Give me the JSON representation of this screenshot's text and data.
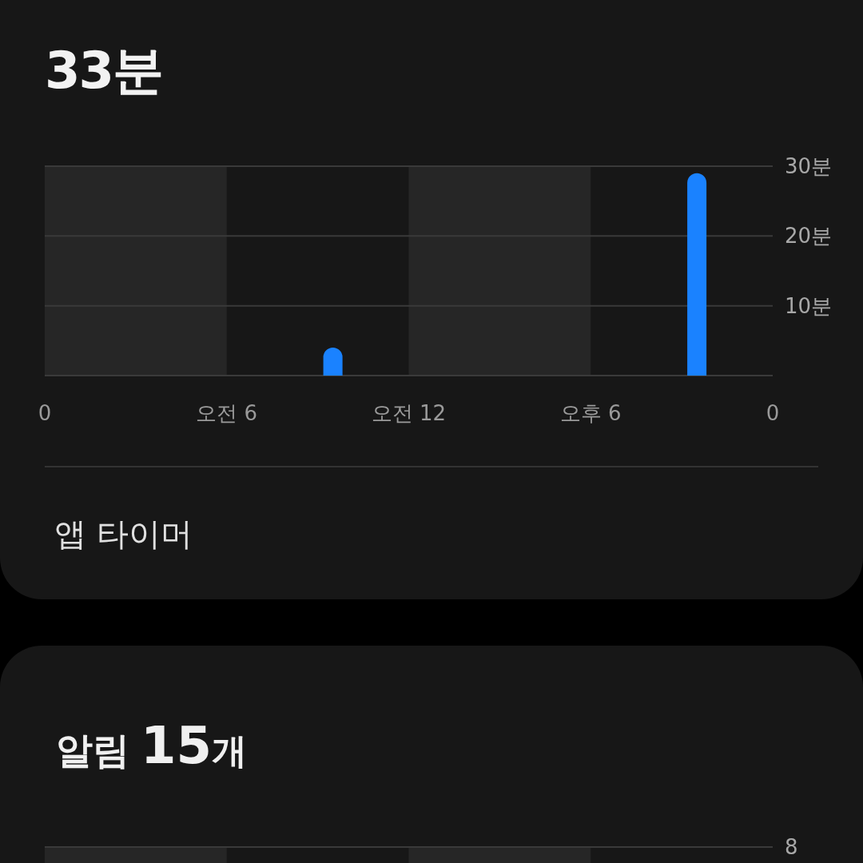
{
  "usage_card": {
    "total": "33분",
    "chart_data": {
      "type": "bar",
      "categories": [
        "0",
        null,
        null,
        null,
        null,
        null,
        "오전 6",
        null,
        null,
        null,
        null,
        null,
        "오전 12",
        null,
        null,
        null,
        null,
        null,
        "오후 6",
        null,
        null,
        null,
        null,
        null
      ],
      "series": [
        {
          "color": "#1a82ff",
          "values": [
            0,
            0,
            0,
            0,
            0,
            0,
            0,
            0,
            0,
            4,
            0,
            0,
            0,
            0,
            0,
            0,
            0,
            0,
            0,
            0,
            0,
            29,
            0,
            0
          ]
        }
      ],
      "ylim": [
        0,
        30
      ],
      "yticks": [
        {
          "value": 10,
          "label": "10분"
        },
        {
          "value": 20,
          "label": "20분"
        },
        {
          "value": 30,
          "label": "30분"
        }
      ]
    },
    "axis_end_label": "0",
    "app_timer": "앱 타이머"
  },
  "notifications_card": {
    "title_label": "알림",
    "count": "15",
    "unit": "개",
    "axis_label": "8"
  }
}
